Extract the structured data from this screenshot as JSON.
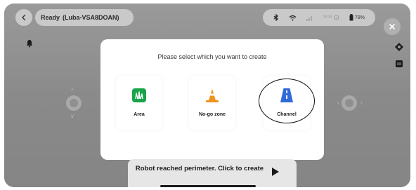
{
  "header": {
    "status": "Ready",
    "device": "(Luba-VSA8DOAN)",
    "positioning": "POS",
    "battery": "78%"
  },
  "dialog": {
    "title": "Please select which you want to create",
    "options": [
      {
        "label": "Area",
        "icon": "grass-area-icon",
        "color": "#1aa34a"
      },
      {
        "label": "No-go zone",
        "icon": "traffic-cone-icon",
        "color": "#f0931e"
      },
      {
        "label": "Channel",
        "icon": "road-channel-icon",
        "color": "#2f6bd8"
      }
    ]
  },
  "bottom_hint": {
    "text": "Robot reached perimeter. Click to create"
  },
  "colors": {
    "overlay": "#8d8d8d",
    "area": "#1aa34a",
    "nogo": "#f0931e",
    "channel": "#2f6bd8"
  }
}
